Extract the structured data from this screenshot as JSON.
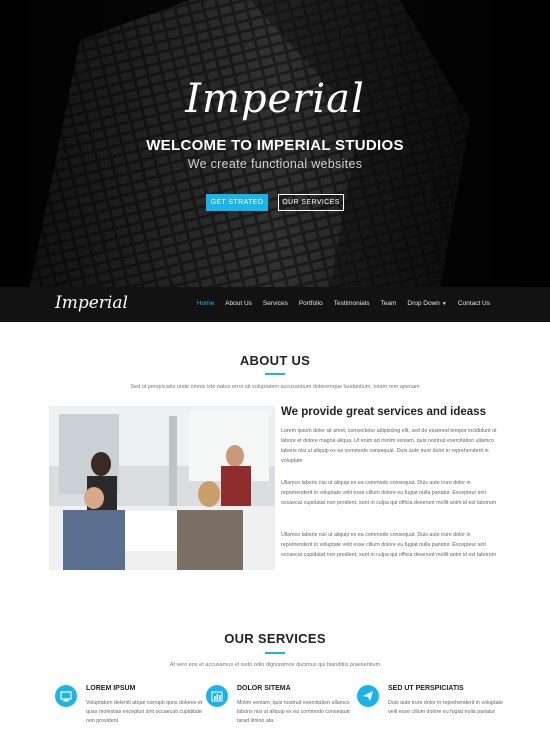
{
  "hero": {
    "logo": "Imperial",
    "title": "WELCOME TO IMPERIAL STUDIOS",
    "subtitle": "We create functional websites",
    "primary_button": "GET STRATED",
    "secondary_button": "OUR SERVICES"
  },
  "navbar": {
    "logo": "Imperial",
    "items": [
      {
        "label": "Home"
      },
      {
        "label": "About Us"
      },
      {
        "label": "Services"
      },
      {
        "label": "Portfolio"
      },
      {
        "label": "Testimonials"
      },
      {
        "label": "Team"
      },
      {
        "label": "Drop Down"
      },
      {
        "label": "Contact Us"
      }
    ]
  },
  "about": {
    "title": "ABOUT US",
    "description": "Sed ut perspiciatis unde omnis iste natus error sit voluptatem accusantium doloremque laudantium, totam rem aperiam",
    "heading": "We provide great services and ideass",
    "paragraphs": [
      "Lorem ipsum dolor sit amet, consectetur adipiscing elit, sed do eiusmod tempor incididunt ut labore et dolore magna aliqua. Ut enim ad minim veniam, quis nostrud exercitation ullamco laboris nisi ut aliquip ex ea commodo consequat. Duis aute irure dolor in reprehenderit in voluptate",
      "Ullamco laboris nisi ut aliquip ex ea commodo consequat. Duis aute irure dolor in reprehenderit in voluptate velit esse cillum dolore eu fugiat nulla pariatur. Excepteur sint occaecat cupidatat non proident, sunt in culpa qui officia deserunt mollit anim id est laborum",
      "Ullamco laboris nisi ut aliquip ex ea commodo consequat. Duis aute irure dolor in reprehenderit in voluptate velit esse cillum dolore eu fugiat nulla pariatur. Excepteur sint occaecat cupidatat non proident, sunt in culpa qui officia deserunt mollit anim id est laborum"
    ]
  },
  "services": {
    "title": "OUR SERVICES",
    "description": "At vero eos et accusamus et iusto odio dignissimos ducimus qui blanditiis praesentium",
    "items": [
      {
        "icon": "monitor-icon",
        "title": "LOREM IPSUM",
        "text": "Voluptatum deleniti atque corrupti quos dolores et quas molestias excepturi sint occaecati cupiditate non provident"
      },
      {
        "icon": "bar-chart-icon",
        "title": "DOLOR SITEMA",
        "text": "Minim veniam, quis nostrud exercitation ullamco laboris nisi ut aliquip ex ea commodo consequat tarad limino ata"
      },
      {
        "icon": "paper-plane-icon",
        "title": "SED UT PERSPICIATIS",
        "text": "Duis aute irure dolor in reprehenderit in voluptate velit esse cillum dolore eu fugiat nulla pariatur"
      }
    ]
  },
  "colors": {
    "accent": "#1ab4e8",
    "navbar_bg": "#121212",
    "hero_bg": "#0e0e0e"
  }
}
